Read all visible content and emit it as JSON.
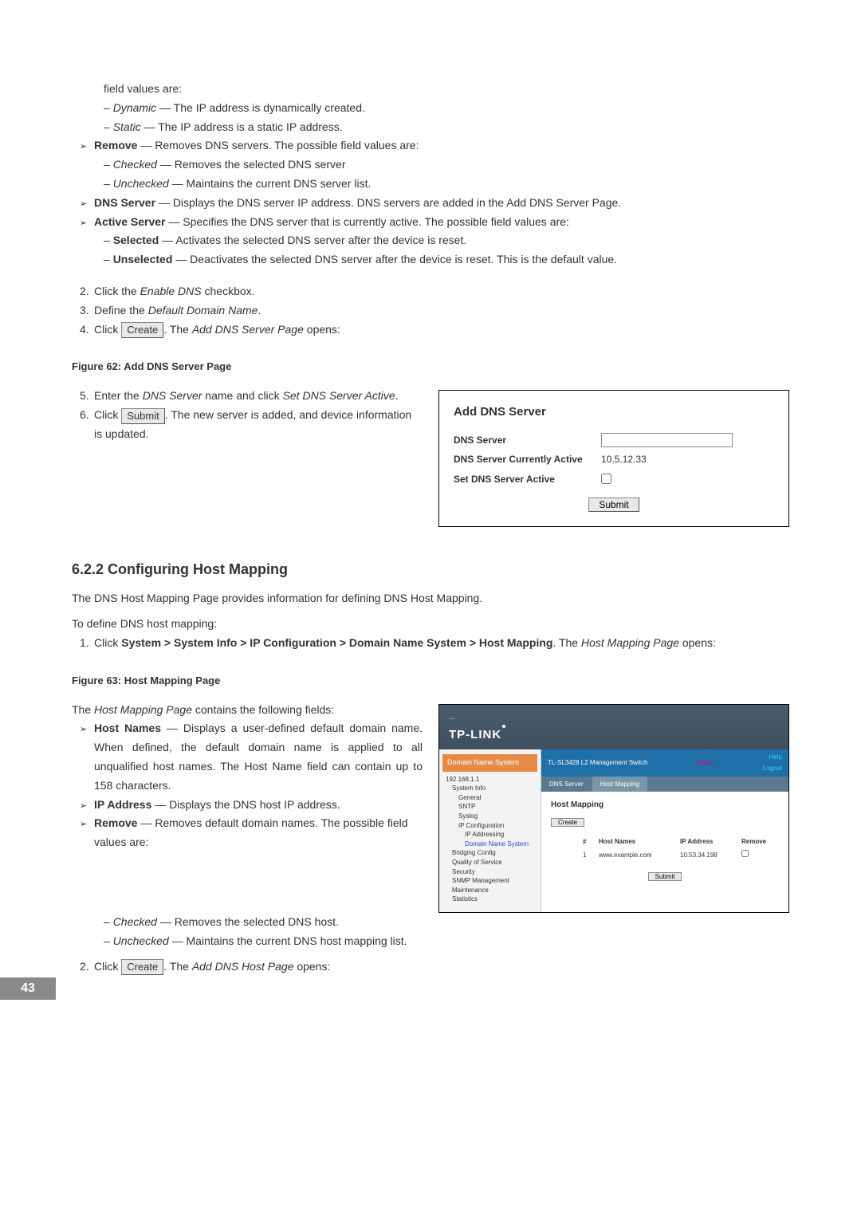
{
  "top": {
    "field_values_are": "field values are:",
    "dynamic_label": "Dynamic",
    "dynamic_text": " — The IP address is dynamically created.",
    "static_label": "Static",
    "static_text": " — The IP address is a static IP address.",
    "remove_label": "Remove",
    "remove_text": " — Removes DNS servers. The possible field values are:",
    "checked_label": "Checked",
    "checked_text": " — Removes the selected DNS server",
    "unchecked_label": "Unchecked",
    "unchecked_text": " — Maintains the current DNS server list.",
    "dns_server_label": "DNS Server",
    "dns_server_text": " — Displays the DNS server IP address. DNS servers are added in the Add DNS Server Page.",
    "active_server_label": "Active Server",
    "active_server_text": " — Specifies the DNS server that is currently active. The possible field values are:",
    "selected_label": "Selected",
    "selected_text": " — Activates the selected DNS server after the device is reset.",
    "unselected_label": "Unselected",
    "unselected_text": " — Deactivates the selected DNS server after the device is reset. This is the default value."
  },
  "steps": {
    "n2": "2.",
    "s2a": "Click the ",
    "s2b": "Enable DNS",
    "s2c": " checkbox.",
    "n3": "3.",
    "s3a": "Define the ",
    "s3b": "Default Domain Name",
    "s3c": ".",
    "n4": "4.",
    "s4a": "Click ",
    "s4b": ". The ",
    "s4c": "Add DNS Server Page",
    "s4d": " opens:",
    "create_btn": "Create"
  },
  "fig62": {
    "caption": "Figure 62: Add DNS Server Page",
    "n5": "5.",
    "s5a": "Enter the ",
    "s5b": "DNS Server",
    "s5c": " name and click ",
    "s5d": "Set DNS Server Active",
    "s5e": ".",
    "n6": "6.",
    "s6a": "Click ",
    "submit_btn": "Submit",
    "s6b": ". The new server is added, and device information is updated."
  },
  "dns_box": {
    "title": "Add DNS Server",
    "row1": "DNS Server",
    "row2": "DNS Server Currently Active",
    "row2_val": "10.5.12.33",
    "row3": "Set DNS Server Active",
    "submit": "Submit"
  },
  "section": {
    "heading": "6.2.2   Configuring Host Mapping",
    "p1": "The DNS Host Mapping Page provides information for defining DNS Host Mapping.",
    "p2": "To define DNS host mapping:",
    "n1": "1.",
    "s1a": "Click ",
    "s1b": "System > System Info > IP Configuration > Domain Name System > Host Mapping",
    "s1c": ". The ",
    "s1d": "Host Mapping Page",
    "s1e": " opens:"
  },
  "fig63": {
    "caption": "Figure 63: Host Mapping Page",
    "intro_a": "The ",
    "intro_b": "Host Mapping Page",
    "intro_c": " contains the following fields:",
    "hostnames_label": "Host Names",
    "hostnames_text": " — Displays a user-defined default domain name. When defined, the default domain name is applied to all unqualified host names. The Host Name field can contain up to 158 characters.",
    "ipaddr_label": "IP Address",
    "ipaddr_text": " — Displays the DNS host IP address.",
    "remove_label": "Remove",
    "remove_text": " — Removes default domain names. The possible field values are:",
    "checked_label": "Checked",
    "checked_text": " — Removes the selected DNS host.",
    "unchecked_label": "Unchecked",
    "unchecked_text": " — Maintains the current DNS host mapping list.",
    "n2": "2.",
    "s2a": "Click ",
    "create_btn": "Create",
    "s2b": ". The ",
    "s2c": "Add DNS Host Page",
    "s2d": " opens:"
  },
  "hm": {
    "brand": "TP-LINK",
    "side_title": "Domain Name System",
    "top_title": "TL-SL3428 L2 Management Switch",
    "about": "About",
    "help": "Help",
    "logout": "Logout",
    "tab1": "DNS Server",
    "tab2": "Host Mapping",
    "content_title": "Host Mapping",
    "create_btn": "Create",
    "col_n": "#",
    "col_host": "Host Names",
    "col_ip": "IP Address",
    "col_rm": "Remove",
    "row_n": "1",
    "row_host": "www.example.com",
    "row_ip": "10.53.34.198",
    "submit": "Submit",
    "tree": {
      "root": "192.168.1.1",
      "sysinfo": "System Info",
      "general": "General",
      "sntp": "SNTP",
      "syslog": "Syslog",
      "ipconf": "IP Configuration",
      "ipaddr": "IP Addressing",
      "dns": "Domain Name System",
      "bridging": "Bridging Config",
      "qos": "Quality of Service",
      "security": "Security",
      "snmp": "SNMP Management",
      "maint": "Maintenance",
      "stats": "Statistics"
    }
  },
  "page_number": "43"
}
